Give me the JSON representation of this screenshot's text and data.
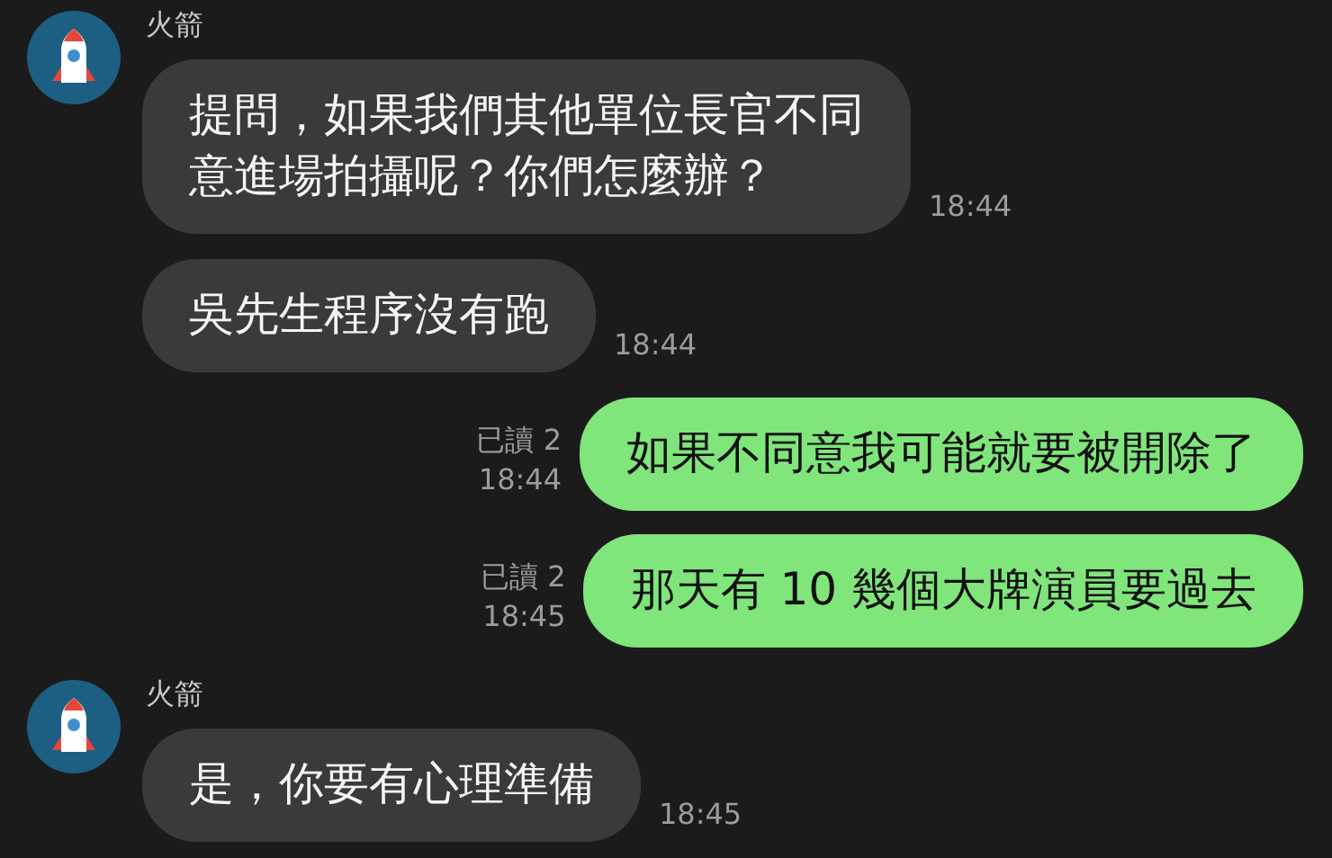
{
  "messages": [
    {
      "kind": "incoming",
      "sender": "火箭",
      "text": "提問，如果我們其他單位長官不同意進場拍攝呢？你們怎麼辦？",
      "time": "18:44"
    },
    {
      "kind": "incoming",
      "text": "吳先生程序沒有跑",
      "time": "18:44"
    },
    {
      "kind": "outgoing",
      "read": "已讀 2",
      "text": "如果不同意我可能就要被開除了",
      "time": "18:44"
    },
    {
      "kind": "outgoing",
      "read": "已讀 2",
      "text": "那天有 10 幾個大牌演員要過去",
      "time": "18:45"
    },
    {
      "kind": "incoming",
      "sender": "火箭",
      "text": "是，你要有心理準備",
      "time": "18:45"
    }
  ]
}
